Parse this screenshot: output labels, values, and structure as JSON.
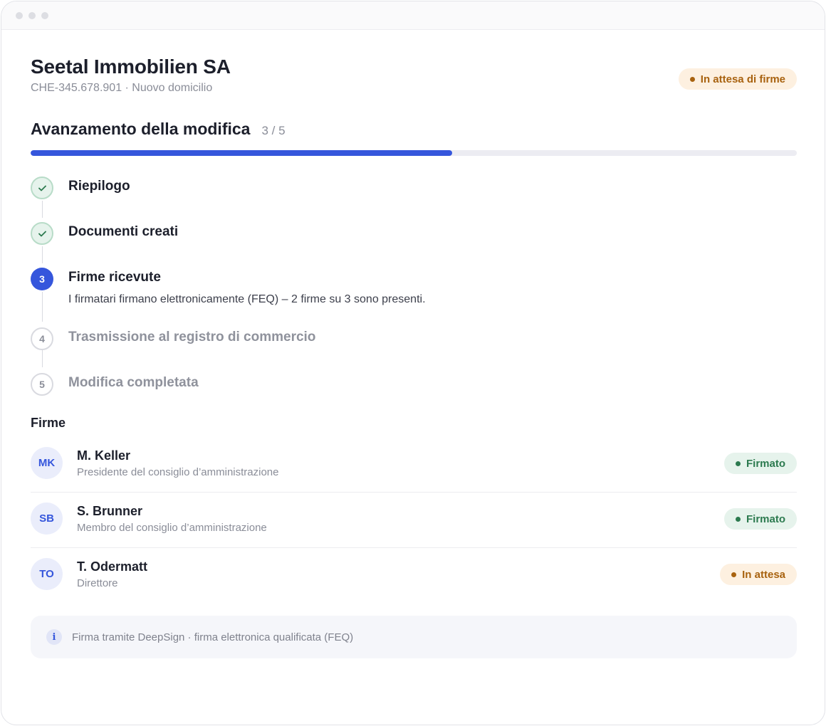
{
  "company": {
    "name": "Seetal Immobilien SA",
    "subtitle": "CHE-345.678.901 · Nuovo domicilio",
    "status": "In attesa di firme"
  },
  "progress": {
    "title": "Avanzamento della modifica",
    "count": "3 / 5",
    "fraction": 0.55
  },
  "steps": [
    {
      "number": "1",
      "label": "Riepilogo",
      "state": "done",
      "icon": "check-icon"
    },
    {
      "number": "2",
      "label": "Documenti creati",
      "state": "done",
      "icon": "check-icon"
    },
    {
      "number": "3",
      "label": "Firme ricevute",
      "state": "current",
      "description": "I firmatari firmano elettronicamente (FEQ) – 2 firme su 3 sono presenti."
    },
    {
      "number": "4",
      "label": "Trasmissione al registro di commercio",
      "state": "pending"
    },
    {
      "number": "5",
      "label": "Modifica completata",
      "state": "pending"
    }
  ],
  "signatures": {
    "title": "Firme",
    "signers": [
      {
        "initials": "MK",
        "name": "M. Keller",
        "role": "Presidente del consiglio d’amministrazione",
        "status": "Firmato",
        "status_type": "ok"
      },
      {
        "initials": "SB",
        "name": "S. Brunner",
        "role": "Membro del consiglio d’amministrazione",
        "status": "Firmato",
        "status_type": "ok"
      },
      {
        "initials": "TO",
        "name": "T. Odermatt",
        "role": "Direttore",
        "status": "In attesa",
        "status_type": "warn"
      }
    ]
  },
  "info": {
    "icon": "info-icon",
    "icon_glyph": "i",
    "text": "Firma tramite DeepSign · firma elettronica qualificata (FEQ)"
  },
  "colors": {
    "accent": "#3556dc",
    "success": "#2c7a4f",
    "warning": "#a8620f"
  }
}
